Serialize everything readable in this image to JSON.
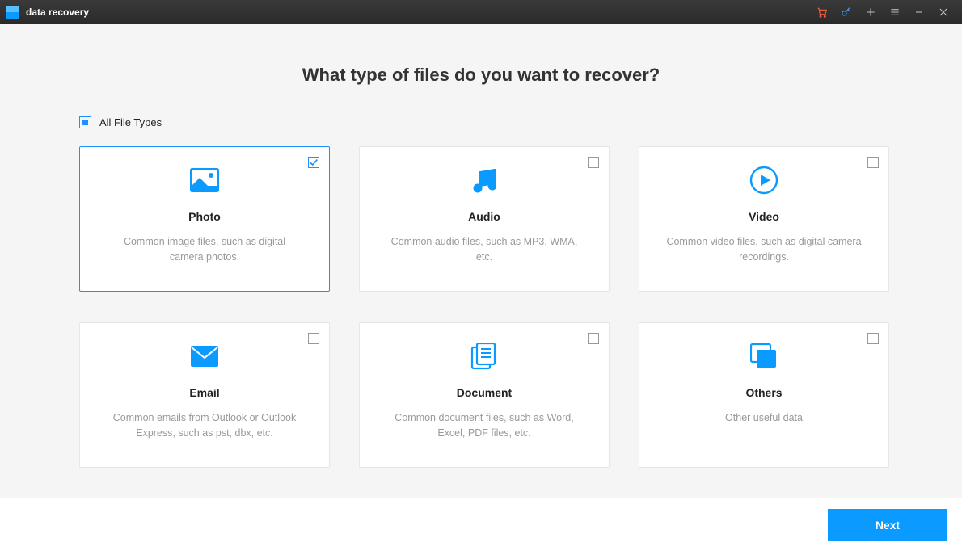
{
  "app": {
    "title": "data recovery"
  },
  "toolbar_icons": [
    "cart",
    "key",
    "plus",
    "menu",
    "minimize",
    "close"
  ],
  "page": {
    "heading": "What type of files do you want to recover?",
    "all_label": "All File Types",
    "all_checked": true,
    "next_label": "Next"
  },
  "cards": [
    {
      "id": "photo",
      "title": "Photo",
      "desc": "Common image files, such as digital camera photos.",
      "selected": true
    },
    {
      "id": "audio",
      "title": "Audio",
      "desc": "Common audio files, such as MP3, WMA, etc.",
      "selected": false
    },
    {
      "id": "video",
      "title": "Video",
      "desc": "Common video files, such as digital camera recordings.",
      "selected": false
    },
    {
      "id": "email",
      "title": "Email",
      "desc": "Common emails from Outlook or Outlook Express, such as pst, dbx, etc.",
      "selected": false
    },
    {
      "id": "document",
      "title": "Document",
      "desc": "Common document files, such as Word, Excel, PDF files, etc.",
      "selected": false
    },
    {
      "id": "others",
      "title": "Others",
      "desc": "Other useful data",
      "selected": false
    }
  ],
  "colors": {
    "accent": "#0b9aff"
  }
}
